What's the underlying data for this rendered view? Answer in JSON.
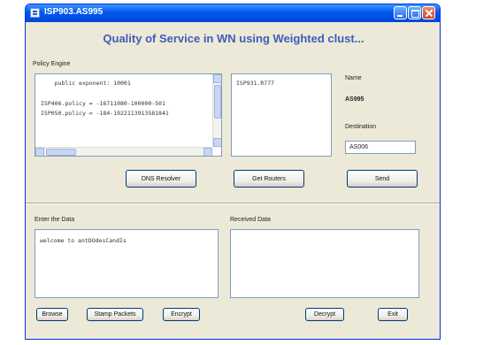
{
  "window": {
    "title": "ISP903.AS995"
  },
  "header": {
    "title": "Quality of Service in WN using Weighted clust..."
  },
  "policy_engine": {
    "label": "Policy Engine",
    "lines": [
      "    public exponent: 10001",
      "",
      "ISP406.policy = -16711080-100000-501",
      "ISP050.policy = -184-1922113913581841"
    ]
  },
  "isp_list": {
    "items": [
      "ISP931.R777"
    ]
  },
  "right_panel": {
    "name_label": "Name",
    "name_value": "AS995",
    "destination_label": "Destination",
    "destination_value": "AS006"
  },
  "buttons": {
    "dns_resolver": "DNS Resolver",
    "get_routers": "Get Routers",
    "send": "Send",
    "browse": "Browse",
    "stamp_packets": "Stamp Packets",
    "encrypt": "Encrypt",
    "decrypt": "Decrypt",
    "exit": "Exit"
  },
  "enter_data": {
    "label": "Enter the Data",
    "text": "welcome to antDOdesCandIs"
  },
  "received_data": {
    "label": "Received Data",
    "text": ""
  },
  "colors": {
    "title_bar": "#0058ee",
    "heading": "#3f5db8",
    "window_bg": "#ece9d8",
    "close_button": "#d2401c"
  }
}
